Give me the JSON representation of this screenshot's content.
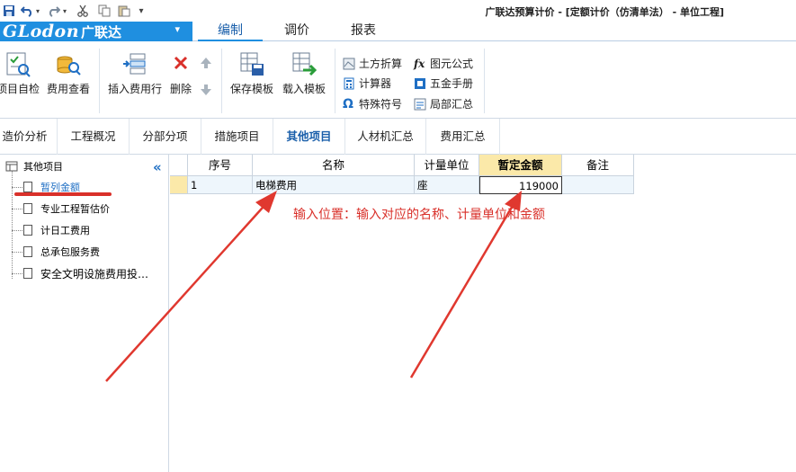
{
  "window_title": "广联达预算计价 - [定额计价（仿清单法） - 单位工程]",
  "quick_access": [
    "save-icon",
    "undo-icon",
    "redo-icon",
    "cut-icon",
    "copy-icon",
    "paste-icon",
    "customize-icon"
  ],
  "logo": {
    "brand": "GLodon",
    "cn": "广联达",
    "dropdown": "▾"
  },
  "ribbon_tabs": [
    "编制",
    "调价",
    "报表"
  ],
  "active_ribbon_tab": "编制",
  "ribbon": {
    "self_check": "项目自检",
    "fee_view": "费用查看",
    "insert_fee_row": "插入费用行",
    "delete": "删除",
    "save_template": "保存模板",
    "load_template": "载入模板",
    "earthwork": "土方折算",
    "calculator": "计算器",
    "special_symbol": "特殊符号",
    "formula": "图元公式",
    "hardware_manual": "五金手册",
    "partial_summary": "局部汇总"
  },
  "nav_tabs": [
    "造价分析",
    "工程概况",
    "分部分项",
    "措施项目",
    "其他项目",
    "人材机汇总",
    "费用汇总"
  ],
  "active_nav_tab": "其他项目",
  "tree": {
    "root": "其他项目",
    "items": [
      "暂列金额",
      "专业工程暂估价",
      "计日工费用",
      "总承包服务费",
      "安全文明设施费用投…"
    ],
    "selected": "暂列金额"
  },
  "grid": {
    "headers": [
      "序号",
      "名称",
      "计量单位",
      "暂定金额",
      "备注"
    ],
    "selected_header": "暂定金额",
    "rows": [
      {
        "no": "1",
        "name": "电梯费用",
        "unit": "座",
        "amount": "119000",
        "remark": ""
      }
    ]
  },
  "annotation": "输入位置：输入对应的名称、计量单位和金额",
  "colors": {
    "accent": "#1f8fe0",
    "annotation": "#d9302a",
    "highlight": "#fbe9a9"
  }
}
